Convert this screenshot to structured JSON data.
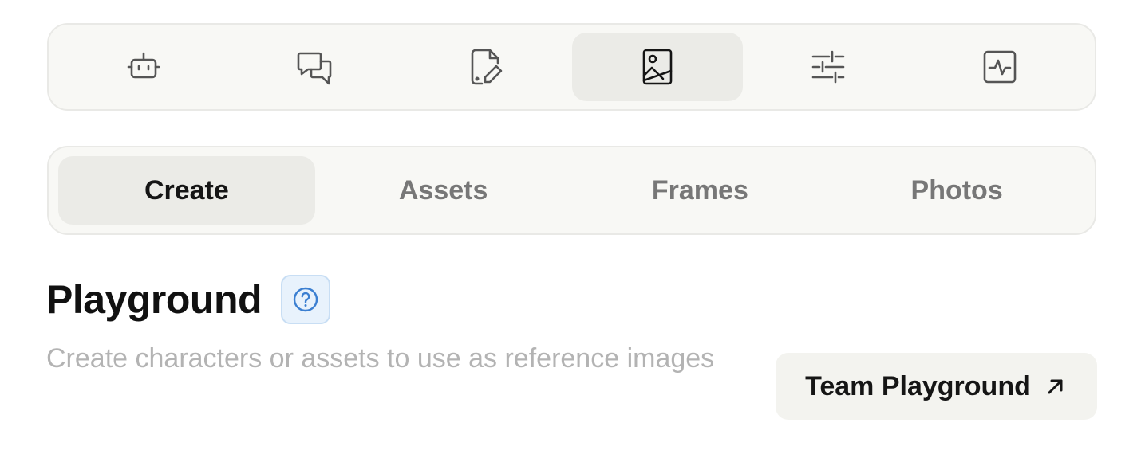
{
  "icon_tabs": [
    {
      "icon": "robot-icon",
      "active": false
    },
    {
      "icon": "chat-bubbles-icon",
      "active": false
    },
    {
      "icon": "file-edit-icon",
      "active": false
    },
    {
      "icon": "image-icon",
      "active": true
    },
    {
      "icon": "sliders-icon",
      "active": false
    },
    {
      "icon": "activity-icon",
      "active": false
    }
  ],
  "segment_tabs": [
    {
      "label": "Create",
      "active": true
    },
    {
      "label": "Assets",
      "active": false
    },
    {
      "label": "Frames",
      "active": false
    },
    {
      "label": "Photos",
      "active": false
    }
  ],
  "header": {
    "title": "Playground",
    "help_icon": "question-circle-icon",
    "subtitle": "Create characters or assets to use as reference images"
  },
  "team_button": {
    "label": "Team Playground",
    "icon": "arrow-up-right-icon"
  },
  "colors": {
    "accent_blue": "#3b7fd1",
    "help_bg": "#e8f2fc",
    "panel_bg": "#f8f8f5",
    "active_tab_bg": "#ebebe7"
  }
}
